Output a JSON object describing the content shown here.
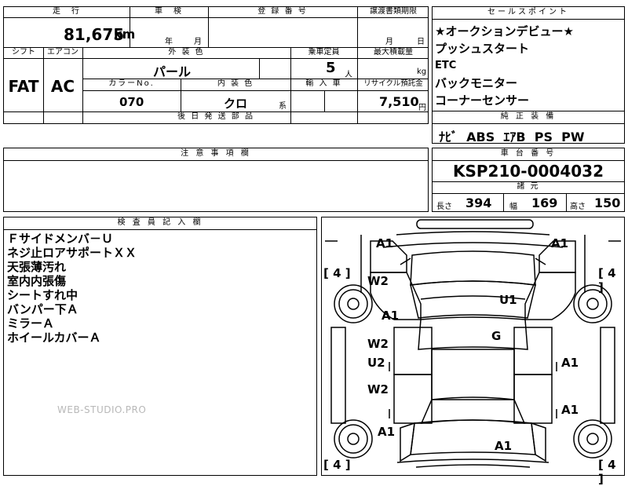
{
  "top": {
    "mileage_header": "走　行",
    "mileage_value": "81,675",
    "mileage_unit": "km",
    "inspection_header": "車　検",
    "inspection_year": "年",
    "inspection_month": "月",
    "registration_header": "登 録 番 号",
    "transfer_header": "譲渡書類期限",
    "transfer_month": "月",
    "transfer_day": "日",
    "shift_header": "シフト",
    "shift_value": "FAT",
    "aircon_header": "エアコン",
    "aircon_value": "AC",
    "exterior_header": "外 装 色",
    "exterior_value": "パール",
    "capacity_header": "乗車定員",
    "capacity_value": "5",
    "capacity_unit": "人",
    "load_header": "最大積載量",
    "load_unit": "kg",
    "color_no_header": "カラーNo.",
    "color_no_value": "070",
    "interior_header": "内 装 色",
    "interior_value": "クロ",
    "interior_unit": "系",
    "import_header": "輸 入 車",
    "recycle_header": "リサイクル預託金",
    "recycle_value": "7,510",
    "recycle_unit": "円",
    "later_parts_header": "後 日 発 送 部 品"
  },
  "sales_points": {
    "header": "セールスポイント",
    "items": [
      "★オークションデビュー★",
      "プッシュスタート",
      "ETC",
      "バックモニター",
      "コーナーセンサー"
    ]
  },
  "equipment": {
    "header": "純 正 装 備",
    "value": "ﾅﾋﾞ  ABS  ｴｱB  PS  PW"
  },
  "caution": {
    "header": "注 意 事 項 欄"
  },
  "chassis": {
    "header": "車 台 番 号",
    "value": "KSP210-0004032",
    "specs_header": "諸 元",
    "length_label": "長さ",
    "length_value": "394",
    "width_label": "幅",
    "width_value": "169",
    "height_label": "高さ",
    "height_value": "150"
  },
  "inspector": {
    "header": "検 査 員 記 入 欄",
    "notes": [
      "Ｆサイドメンバ－Ｕ",
      "ネジ止ロアサポートＸＸ",
      "天張薄汚れ",
      "室内内張傷",
      "シートすれ中",
      "バンパー下Ａ",
      "ミラーＡ",
      "ホイールカバーＡ"
    ]
  },
  "diagram": {
    "tread_values": [
      "4",
      "4",
      "4",
      "4"
    ],
    "marks": [
      "A1",
      "A1",
      "W2",
      "U1",
      "A1",
      "W2",
      "G",
      "U2",
      "A1",
      "W2",
      "A1",
      "A1",
      "A1"
    ]
  },
  "watermark": "WEB-STUDIO.PRO"
}
